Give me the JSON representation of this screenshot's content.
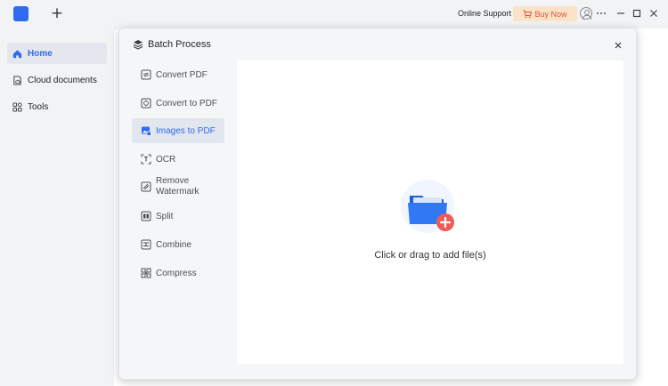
{
  "topbar": {
    "new_tab_symbol": "+",
    "online_support": "Online Support",
    "buy_now": "Buy Now",
    "window_controls": [
      "more-icon",
      "minimize-icon",
      "maximize-icon",
      "close-icon"
    ]
  },
  "sidebar": {
    "items": [
      {
        "label": "Home",
        "icon": "home-icon",
        "active": true
      },
      {
        "label": "Cloud documents",
        "icon": "cloud-document-icon",
        "active": false
      },
      {
        "label": "Tools",
        "icon": "tools-grid-icon",
        "active": false
      }
    ]
  },
  "modal": {
    "title": "Batch Process",
    "tools": [
      {
        "label": "Convert PDF",
        "icon": "convert-pdf-icon",
        "active": false
      },
      {
        "label": "Convert to PDF",
        "icon": "convert-to-pdf-icon",
        "active": false
      },
      {
        "label": "Images to PDF",
        "icon": "images-to-pdf-icon",
        "active": true
      },
      {
        "label": "OCR",
        "icon": "ocr-icon",
        "active": false
      },
      {
        "label_line1": "Remove",
        "label_line2": "Watermark",
        "icon": "remove-watermark-icon",
        "active": false
      },
      {
        "label": "Split",
        "icon": "split-icon",
        "active": false
      },
      {
        "label": "Combine",
        "icon": "combine-icon",
        "active": false
      },
      {
        "label": "Compress",
        "icon": "compress-icon",
        "active": false
      }
    ],
    "drop_text": "Click or drag to add file(s)"
  },
  "colors": {
    "accent": "#2f6bf0",
    "buy_now_bg": "#fbe3c7",
    "buy_now_text": "#e5513e",
    "add_badge": "#ef5b57"
  }
}
